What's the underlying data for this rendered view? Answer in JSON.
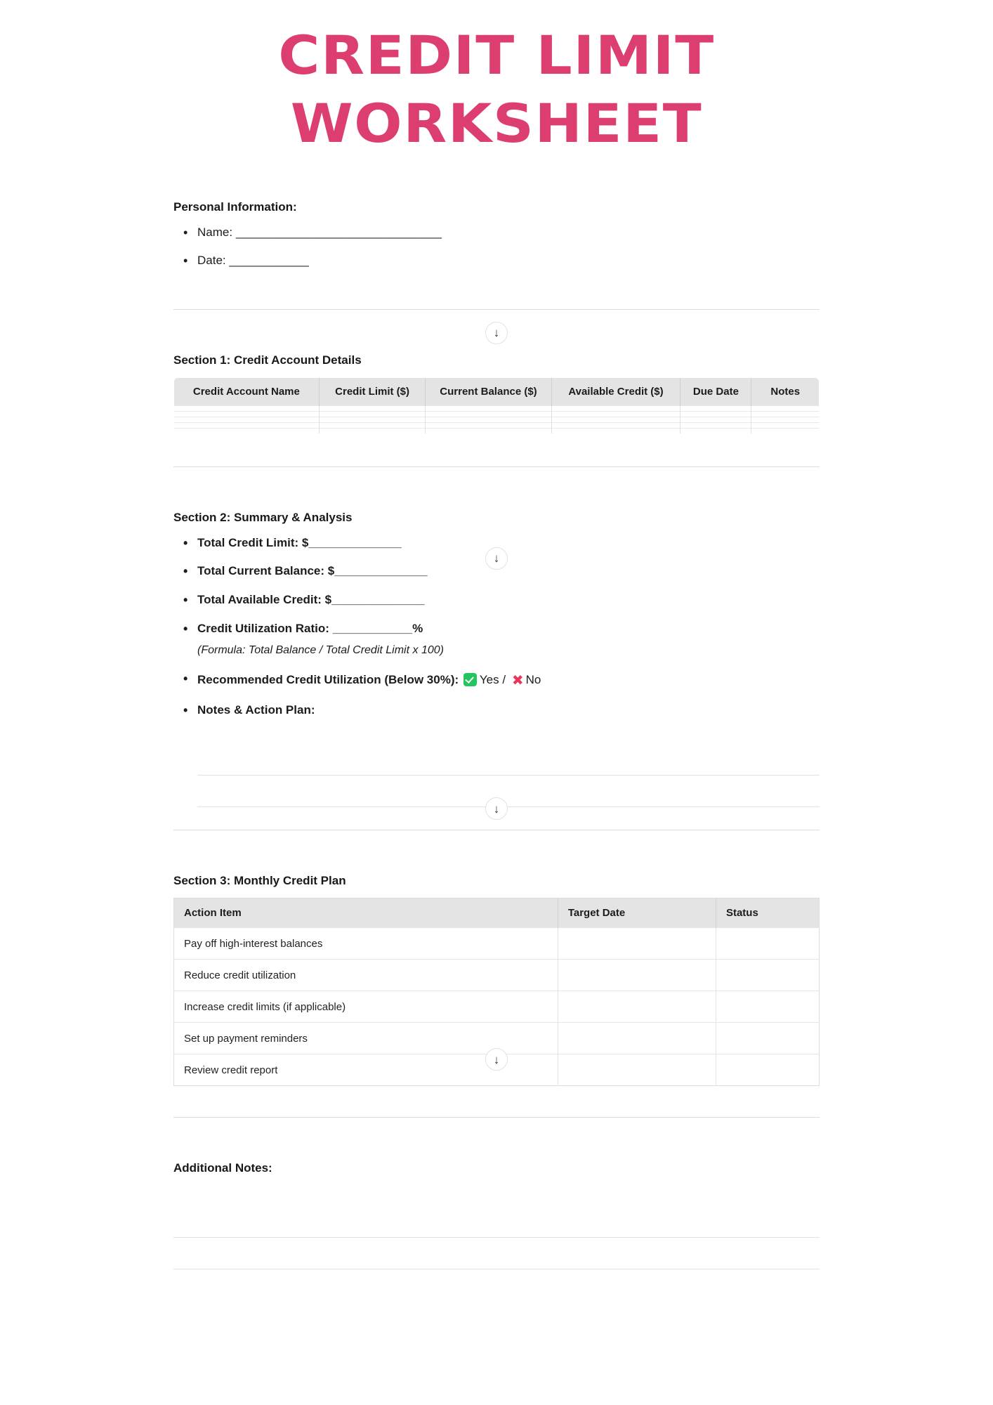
{
  "document": {
    "title": "CREDIT LIMIT WORKSHEET",
    "title_color": "#dd3e70"
  },
  "personal_information": {
    "heading": "Personal Information:",
    "fields": [
      {
        "label": "Name:",
        "blank": "_______________________________"
      },
      {
        "label": "Date:",
        "blank": "____________"
      }
    ]
  },
  "icons": {
    "scroll_down_arrow": "↓"
  },
  "section_1": {
    "heading": "Section 1: Credit Account Details",
    "columns": [
      "Credit Account Name",
      "Credit Limit ($)",
      "Current Balance ($)",
      "Available Credit ($)",
      "Due Date",
      "Notes"
    ],
    "empty_row_count": 5
  },
  "section_2": {
    "heading": "Section 2: Summary & Analysis",
    "items": [
      {
        "label": "Total Credit Limit: $",
        "blank": "______________"
      },
      {
        "label": "Total Current Balance: $",
        "blank": "______________"
      },
      {
        "label": "Total Available Credit: $",
        "blank": "______________"
      },
      {
        "label": "Credit Utilization Ratio: ",
        "blank": "____________",
        "suffix": "%",
        "note": "(Formula: Total Balance / Total Credit Limit x 100)"
      }
    ],
    "recommendation": {
      "label": "Recommended Credit Utilization (Below 30%):",
      "yes_label": "Yes",
      "separator": "/",
      "no_label": "No",
      "yes_icon": "check-mark",
      "no_icon": "cross-mark",
      "yes_color": "#22c55e",
      "no_color": "#e8365d"
    },
    "notes_label": "Notes & Action Plan:",
    "notes_line_count": 2
  },
  "section_3": {
    "heading": "Section 3: Monthly Credit Plan",
    "columns": [
      "Action Item",
      "Target Date",
      "Status"
    ],
    "rows": [
      {
        "action_item": "Pay off high-interest balances",
        "target_date": "",
        "status": ""
      },
      {
        "action_item": "Reduce credit utilization",
        "target_date": "",
        "status": ""
      },
      {
        "action_item": "Increase credit limits (if applicable)",
        "target_date": "",
        "status": ""
      },
      {
        "action_item": "Set up payment reminders",
        "target_date": "",
        "status": ""
      },
      {
        "action_item": "Review credit report",
        "target_date": "",
        "status": ""
      }
    ]
  },
  "additional_notes": {
    "heading": "Additional Notes:",
    "line_count": 2
  }
}
